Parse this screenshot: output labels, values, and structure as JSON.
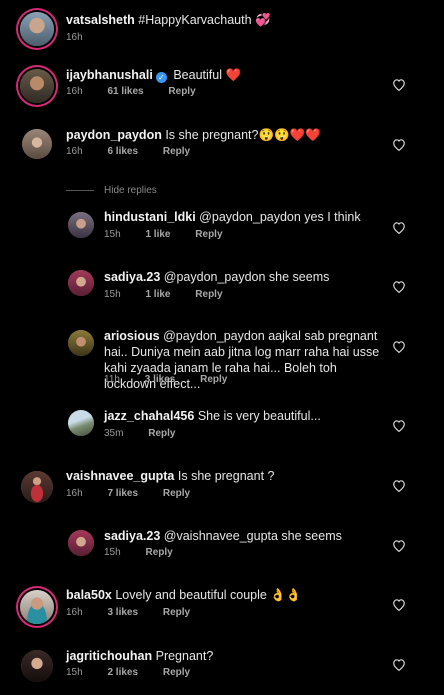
{
  "comments": [
    {
      "user": "vatsalsheth",
      "text": "#HappyKarvachauth 💞",
      "time": "16h",
      "likes": "",
      "reply": "",
      "verified": false
    },
    {
      "user": "ijaybhanushali",
      "text": "Beautiful ❤️",
      "time": "16h",
      "likes": "61 likes",
      "reply": "Reply",
      "verified": true
    },
    {
      "user": "paydon_paydon",
      "text": "Is she pregnant?😲😲❤️❤️",
      "time": "16h",
      "likes": "6 likes",
      "reply": "Reply",
      "verified": false
    },
    {
      "user": "hindustani_ldki",
      "text": "@paydon_paydon yes I think",
      "time": "15h",
      "likes": "1 like",
      "reply": "Reply",
      "verified": false
    },
    {
      "user": "sadiya.23",
      "text": "@paydon_paydon she seems",
      "time": "15h",
      "likes": "1 like",
      "reply": "Reply",
      "verified": false
    },
    {
      "user": "ariosious",
      "text": "@paydon_paydon aajkal sab pregnant hai.. Duniya mein aab jitna log marr raha hai usse kahi zyaada janam le raha hai... Boleh toh lockdown effect...",
      "time": "11h",
      "likes": "3 likes",
      "reply": "Reply",
      "verified": false
    },
    {
      "user": "jazz_chahal456",
      "text": "She is very beautiful...",
      "time": "35m",
      "likes": "",
      "reply": "Reply",
      "verified": false
    },
    {
      "user": "vaishnavee_gupta",
      "text": "Is she pregnant ?",
      "time": "16h",
      "likes": "7 likes",
      "reply": "Reply",
      "verified": false
    },
    {
      "user": "sadiya.23",
      "text": "@vaishnavee_gupta she seems",
      "time": "15h",
      "likes": "",
      "reply": "Reply",
      "verified": false
    },
    {
      "user": "bala50x",
      "text": "Lovely and beautiful couple 👌👌",
      "time": "16h",
      "likes": "3 likes",
      "reply": "Reply",
      "verified": false
    },
    {
      "user": "jagritichouhan",
      "text": "Pregnant?",
      "time": "15h",
      "likes": "2 likes",
      "reply": "Reply",
      "verified": false
    }
  ],
  "hide_replies_label": "Hide replies",
  "colors": {
    "background": "#000000",
    "story_ring": "#d62976",
    "verified": "#3897f0",
    "heart": "#ff3040"
  }
}
